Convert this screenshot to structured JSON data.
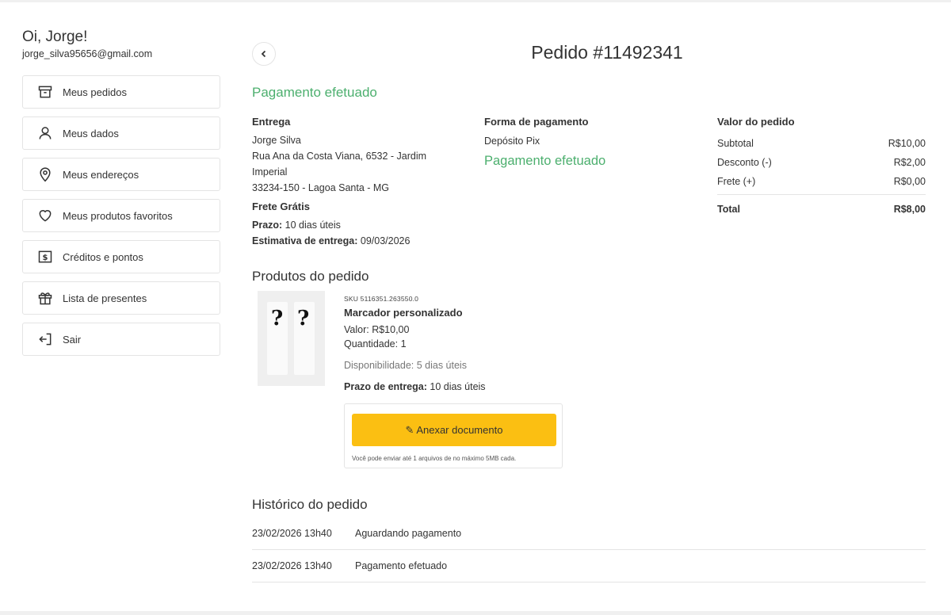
{
  "user": {
    "greeting": "Oi, Jorge!",
    "email": "jorge_silva95656@gmail.com"
  },
  "menu": [
    {
      "label": "Meus pedidos",
      "icon": "archive-icon"
    },
    {
      "label": "Meus dados",
      "icon": "user-icon"
    },
    {
      "label": "Meus endereços",
      "icon": "location-pin-icon"
    },
    {
      "label": "Meus produtos favoritos",
      "icon": "heart-icon"
    },
    {
      "label": "Créditos e pontos",
      "icon": "dollar-bill-icon"
    },
    {
      "label": "Lista de presentes",
      "icon": "gift-icon"
    },
    {
      "label": "Sair",
      "icon": "logout-icon"
    }
  ],
  "order": {
    "title": "Pedido #11492341",
    "status": "Pagamento efetuado"
  },
  "entrega": {
    "title": "Entrega",
    "name": "Jorge Silva",
    "address_line1": "Rua Ana da Costa Viana, 6532 - Jardim",
    "address_line2": "Imperial",
    "address_line3": "33234-150 - Lagoa Santa - MG",
    "frete": "Frete Grátis",
    "prazo_label": "Prazo:",
    "prazo_value": " 10 dias úteis",
    "estimativa_label": "Estimativa de entrega:",
    "estimativa_value": " 09/03/2026"
  },
  "pagamento": {
    "title": "Forma de pagamento",
    "method": "Depósito Pix",
    "status": "Pagamento efetuado"
  },
  "valor": {
    "title": "Valor do pedido",
    "rows": [
      {
        "label": "Subtotal",
        "value": "R$10,00"
      },
      {
        "label": "Desconto (-)",
        "value": "R$2,00"
      },
      {
        "label": "Frete (+)",
        "value": "R$0,00"
      }
    ],
    "total_label": "Total",
    "total_value": "R$8,00"
  },
  "produtos": {
    "title": "Produtos do pedido",
    "items": [
      {
        "sku": "SKU 5116351.263550.0",
        "name": "Marcador personalizado",
        "valor": "Valor: R$10,00",
        "quantidade": "Quantidade: 1",
        "disponibilidade": "Disponibilidade: 5 dias úteis",
        "prazo_label": "Prazo de entrega:",
        "prazo_value": " 10 dias úteis",
        "upload_label": "✎ Anexar documento",
        "upload_note": "Você pode enviar até 1 arquivos de no máximo 5MB cada.",
        "image_glyphs": [
          "?",
          "?"
        ]
      }
    ]
  },
  "historico": {
    "title": "Histórico do pedido",
    "rows": [
      {
        "date": "23/02/2026 13h40",
        "status": "Aguardando pagamento"
      },
      {
        "date": "23/02/2026 13h40",
        "status": "Pagamento efetuado"
      }
    ]
  },
  "colors": {
    "success_green": "#4caf6e",
    "upload_button": "#fbbf12",
    "border": "#e4e4e4"
  }
}
